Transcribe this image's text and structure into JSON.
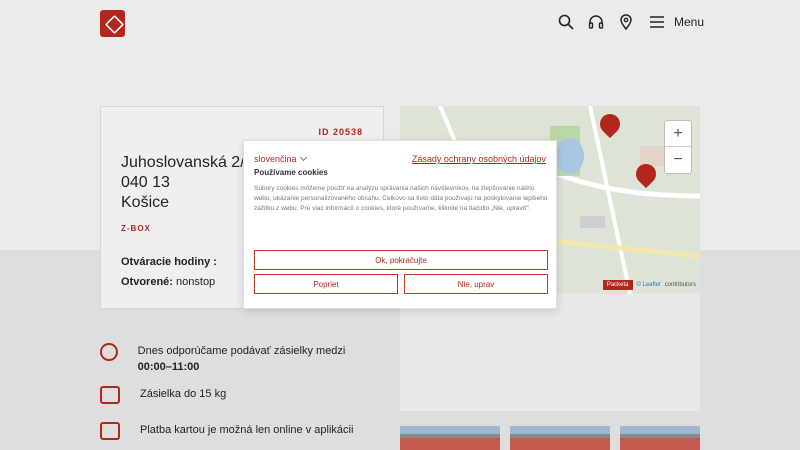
{
  "header": {
    "menu_label": "Menu",
    "icons": [
      "search-icon",
      "headset-icon",
      "location-pin-icon",
      "hamburger-icon"
    ]
  },
  "card": {
    "id": "ID 20538",
    "street": "Juhoslovanská 2/A",
    "zip": "040 13",
    "city": "Košice",
    "type": "Z-BOX",
    "hours_label": "Otváracie hodiny :",
    "open_label": "Otvorené:",
    "open_value": "nonstop"
  },
  "map": {
    "zoom_in": "+",
    "zoom_out": "−",
    "brand": "Packeta",
    "leaflet": "© Leaflet",
    "contributors": "contributors"
  },
  "info": [
    {
      "icon": "clock-icon",
      "text": "Dnes odporúčame podávať zásielky medzi ",
      "bold": "00:00–11:00"
    },
    {
      "icon": "weight-icon",
      "text": "Zásielka do 15 kg",
      "bold": ""
    },
    {
      "icon": "card-icon",
      "text": "Platba kartou je možná len online v aplikácii",
      "bold": ""
    }
  ],
  "cookie": {
    "language": "slovenčina",
    "policy_link": "Zásady ochrany osobných údajov",
    "title": "Používame cookies",
    "text": "Súbory cookies môžeme použiť na analýzu správania našich návštevníkov, na zlepšovanie nášho webu, ukázanie personalizovaného obsahu. Celkovo sa tieto dáta používajú na poskytovanie lepšieho zážitku z webu. Pre viac informácií o cookies, ktoré používame, kliknite na tlačidlo „Nie, upraviť\".",
    "accept": "Ok, pokračujte",
    "reject": "Popriet",
    "customize": "Nie, uprav"
  },
  "colors": {
    "accent": "#b3261e"
  }
}
